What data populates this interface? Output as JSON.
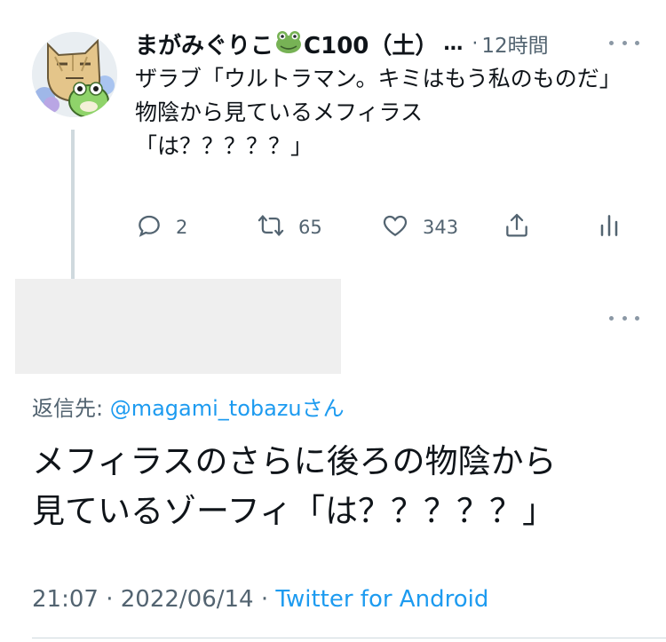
{
  "parent_tweet": {
    "author_name": "まがみぐりこ",
    "frog_emoji": "frog-emoji",
    "author_name_rest": "C100（土）",
    "ellipsis": "…",
    "dot": "·",
    "time_ago": "12時間",
    "more_icon": "more-horizontal-icon",
    "text": "ザラブ「ウルトラマン。キミはもう私のものだ」\n物陰から見ているメフィラス\n「は？？？？？」",
    "actions": {
      "reply_count": "2",
      "retweet_count": "65",
      "like_count": "343"
    }
  },
  "reply_tweet": {
    "more_icon": "more-horizontal-icon",
    "reply_to_prefix": "返信先: ",
    "reply_to_handle": "@magami_tobazu",
    "reply_to_suffix": "さん",
    "text": "メフィラスのさらに後ろの物陰から\n見ているゾーフィ「は？？？？？」",
    "time": "21:07",
    "separator1": " · ",
    "date": "2022/06/14",
    "separator2": " · ",
    "source": "Twitter for Android"
  },
  "colors": {
    "text_primary": "#0f1419",
    "text_secondary": "#536471",
    "accent_link": "#1d9bf0",
    "divider": "#cfd9de"
  }
}
